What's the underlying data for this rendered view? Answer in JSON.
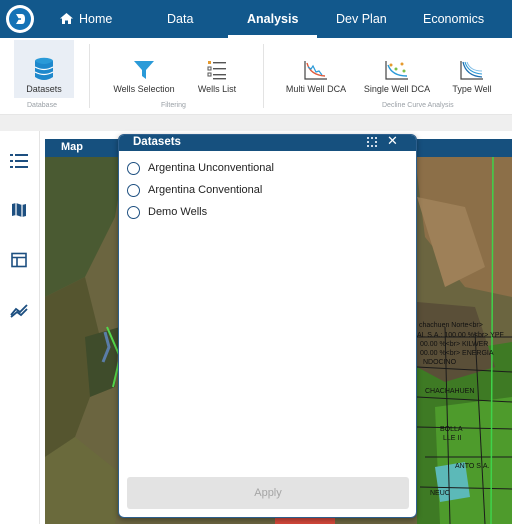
{
  "nav": {
    "items": [
      {
        "label": "Home"
      },
      {
        "label": "Data"
      },
      {
        "label": "Analysis"
      },
      {
        "label": "Dev Plan"
      },
      {
        "label": "Economics"
      }
    ],
    "active": "Analysis"
  },
  "ribbon": {
    "groups": [
      {
        "label": "Database",
        "buttons": [
          {
            "label": "Datasets"
          }
        ]
      },
      {
        "label": "Filtering",
        "buttons": [
          {
            "label": "Wells Selection"
          },
          {
            "label": "Wells List"
          }
        ]
      },
      {
        "label": "Decline Curve Analysis",
        "buttons": [
          {
            "label": "Multi Well DCA"
          },
          {
            "label": "Single Well DCA"
          },
          {
            "label": "Type Well"
          }
        ]
      }
    ]
  },
  "sidebar": {
    "icons": [
      "list-icon",
      "map-icon",
      "table-icon",
      "chart-icon"
    ]
  },
  "map": {
    "title": "Map",
    "labels": [
      "chachuen Norte<br>",
      "AL S.A.: 100.00 %<br> YPF",
      "00.00 %<br> KILWER",
      "00.00 %<br> ENERGIA",
      "NDOCINO",
      "CHACHAHUEN",
      "BOLLA",
      "LLE II",
      "ANTO S.A.",
      "NEUC"
    ]
  },
  "dialog": {
    "title": "Datasets",
    "options": [
      {
        "label": "Argentina Unconventional"
      },
      {
        "label": "Argentina Conventional"
      },
      {
        "label": "Demo Wells"
      }
    ],
    "apply_label": "Apply"
  },
  "colors": {
    "nav_bg": "#12588c",
    "header_bg": "#16507e",
    "accent": "#1572b6"
  }
}
